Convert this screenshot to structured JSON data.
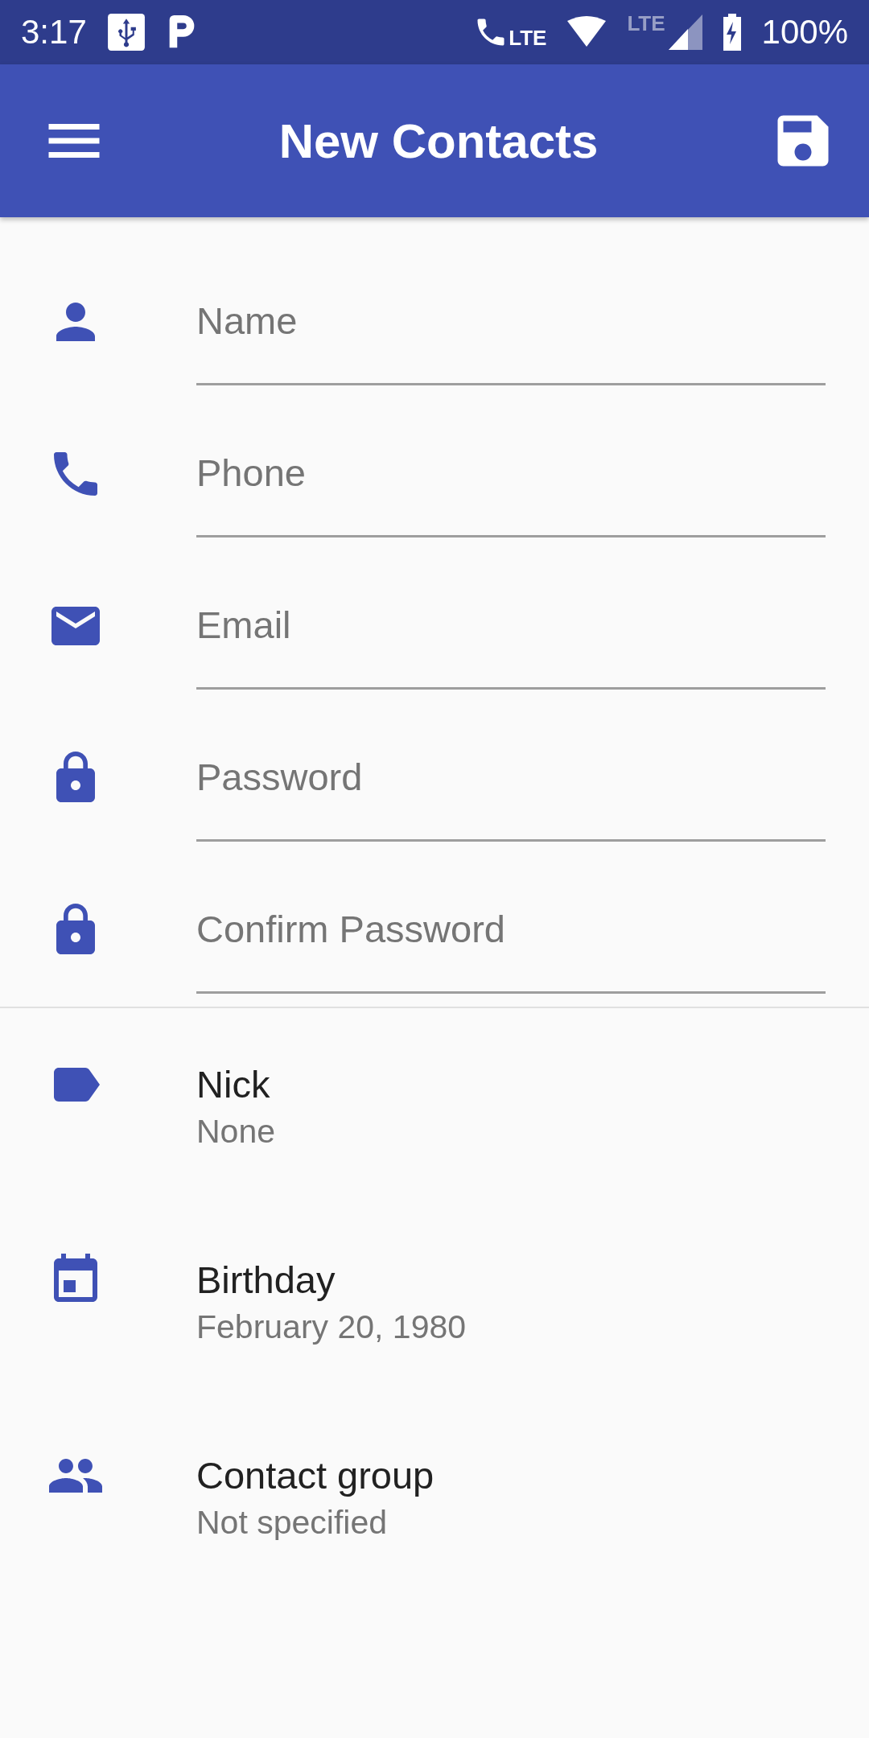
{
  "status_bar": {
    "time": "3:17",
    "call_network": "LTE",
    "network": "LTE",
    "battery": "100%"
  },
  "app_bar": {
    "title": "New Contacts"
  },
  "fields": [
    {
      "placeholder": "Name"
    },
    {
      "placeholder": "Phone"
    },
    {
      "placeholder": "Email"
    },
    {
      "placeholder": "Password"
    },
    {
      "placeholder": "Confirm Password"
    }
  ],
  "details": [
    {
      "label": "Nick",
      "value": "None"
    },
    {
      "label": "Birthday",
      "value": "February 20, 1980"
    },
    {
      "label": "Contact group",
      "value": "Not specified"
    }
  ]
}
